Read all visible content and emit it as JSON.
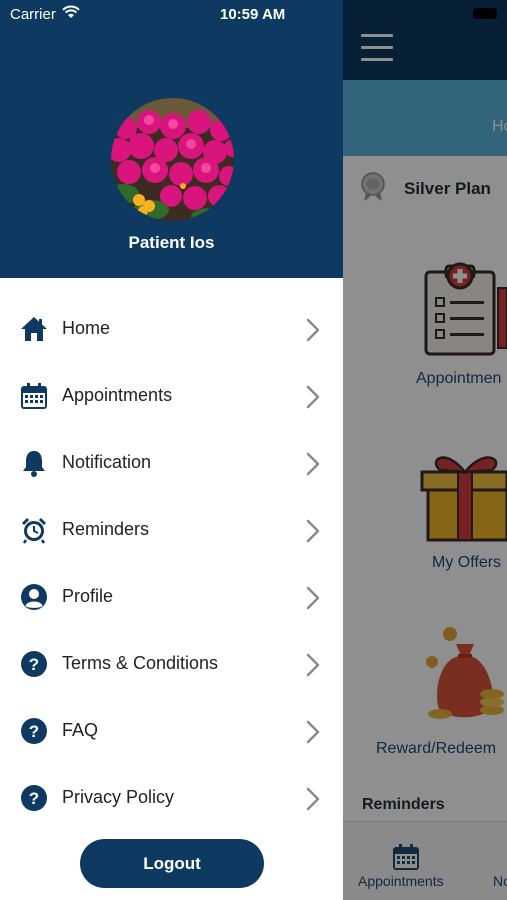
{
  "status_bar": {
    "carrier": "Carrier",
    "time": "10:59 AM"
  },
  "drawer": {
    "patient_name": "Patient Ios",
    "menu": [
      {
        "label": "Home",
        "icon": "home-icon"
      },
      {
        "label": "Appointments",
        "icon": "calendar-icon"
      },
      {
        "label": "Notification",
        "icon": "bell-icon"
      },
      {
        "label": "Reminders",
        "icon": "alarm-clock-icon"
      },
      {
        "label": "Profile",
        "icon": "user-icon"
      },
      {
        "label": "Terms & Conditions",
        "icon": "question-icon"
      },
      {
        "label": "FAQ",
        "icon": "question-icon"
      },
      {
        "label": "Privacy Policy",
        "icon": "question-icon"
      }
    ],
    "logout_label": "Logout"
  },
  "background_screen": {
    "banner_text": "Ho",
    "plan_label": "Silver Plan",
    "cards": [
      {
        "label": "Appointmen",
        "icon": "clipboard-icon"
      },
      {
        "label": "My Offers",
        "icon": "gift-icon"
      },
      {
        "label": "Reward/Redeem",
        "icon": "money-bag-icon"
      }
    ],
    "reminders_title": "Reminders",
    "tabs": [
      {
        "label": "Appointments",
        "icon": "calendar-icon"
      },
      {
        "label": "No"
      }
    ]
  },
  "colors": {
    "navy": "#0e3a61",
    "banner_blue": "#5ab5de",
    "chevron_gray": "#8a8a8a"
  }
}
